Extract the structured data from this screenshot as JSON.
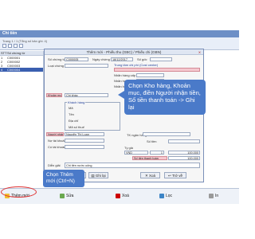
{
  "window": {
    "title": "Chi tiền"
  },
  "subbar": {
    "pager": "Trang 1 / 1 (Tổng số bản ghi: 4)"
  },
  "list": {
    "headers": [
      "STT",
      "Số chứng từ"
    ],
    "rows": [
      {
        "stt": "1",
        "code": "C000001"
      },
      {
        "stt": "2",
        "code": "C000002"
      },
      {
        "stt": "3",
        "code": "C000003"
      },
      {
        "stt": "4",
        "code": "C000004"
      }
    ]
  },
  "dialog": {
    "title": "Thêm mới - Phiếu thu (GBC) / Phiếu chi (GBN)",
    "close": "X",
    "so_chung_tu_label": "Số chứng từ",
    "so_chung_tu_value": "C000005",
    "ngay_chung_tu_label": "Ngày chứng từ",
    "ngay_chung_tu_value": "18/12/2017",
    "so_goc_label": "Số gốc",
    "loai_chung_tu_label": "Loại chứng từ",
    "trung_tam_label": "Trung tâm chi phí (Cost center)",
    "kho_hang_label": "Kho hàng",
    "nhan_hang_cap_tren_label": "Nhãn hàng cấp trên",
    "nhan_hang_label": "Nhãn hàng",
    "nhan_hang_cap_duoi_label": "Nhãn hàng cấp dưới",
    "khoan_muc_label": "Khoản mục",
    "khoan_muc_value": "Chi khác",
    "doi_tuong_label": "Đối tượng",
    "khach_hang_label": "Khách hàng",
    "ma_label": "Mã",
    "ten_label": "Tên",
    "dia_chi_label": "Địa chỉ",
    "ma_so_thue_label": "Mã số thuế",
    "nguoi_nhan_label": "Người nhận tiền",
    "nguoi_nhan_value": "Nguyễn Thị Loan",
    "tk_ngan_hang_label": "TK ngân hàng",
    "no_tai_khoan_label": "Nợ tài khoản",
    "co_tai_khoan_label": "Có tài khoản",
    "so_tien_label": "Số tiền",
    "ty_gia_label": "Tỷ giá",
    "ty_gia_currency": "VND",
    "ty_gia_value": "1",
    "so_tien_value": "100,000",
    "so_tien_thanh_toan_label": "Số tiền thanh toán",
    "so_tien_thanh_toan_value": "100,000",
    "dien_giai_label": "Diễn giải",
    "dien_giai_value": "Chi tiền nước uống",
    "btn_them_moi": "Thêm mới",
    "btn_ghi_lai": "Ghi lại",
    "btn_xoa": "Xoá",
    "btn_tro_ve": "Trở về"
  },
  "callout_main": "Chọn Kho hàng, Khoản mục, điền Người nhận tiền, Số tiền thanh toán -> Ghi lại",
  "callout_add": "Chọn Thêm mới (Ctrl+N)",
  "bottombar": {
    "them_moi": "Thêm mới",
    "sua": "Sửa",
    "xoa": "Xoá",
    "loc": "Lọc",
    "in": "In"
  },
  "colors": {
    "accent": "#4a7ac9",
    "required_field": "#f5c9cf",
    "highlight_circle": "#e03030"
  }
}
